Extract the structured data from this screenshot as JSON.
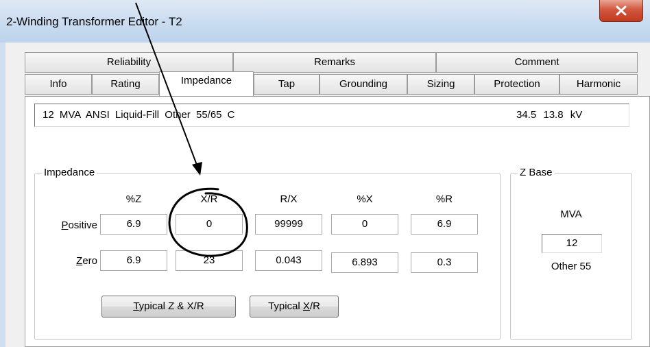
{
  "window": {
    "title": "2-Winding Transformer Editor - T2"
  },
  "tabs_top": [
    "Reliability",
    "Remarks",
    "Comment"
  ],
  "tabs_bottom": [
    "Info",
    "Rating",
    "Impedance",
    "Tap",
    "Grounding",
    "Sizing",
    "Protection",
    "Harmonic"
  ],
  "active_tab": "Impedance",
  "description": {
    "left": "12 MVA ANSI Liquid-Fill Other 55/65 C",
    "right": "34.5 13.8 kV"
  },
  "impedance": {
    "legend": "Impedance",
    "columns": [
      "%Z",
      "X/R",
      "R/X",
      "%X",
      "%R"
    ],
    "positive": {
      "label": "Positive",
      "mnemonic": "P",
      "rest": "ositive",
      "values": [
        "6.9",
        "0",
        "99999",
        "0",
        "6.9"
      ]
    },
    "zero": {
      "label": "Zero",
      "mnemonic": "Z",
      "rest": "ero",
      "values": [
        "6.9",
        "23",
        "0.043",
        "6.893",
        "0.3"
      ]
    }
  },
  "buttons": {
    "typical_z_xr": {
      "mnemonic": "T",
      "rest": "ypical Z & X/R"
    },
    "typical_xr": {
      "pre": "Typical ",
      "mnemonic": "X",
      "rest": "/R"
    }
  },
  "zbase": {
    "legend": "Z Base",
    "mva_label": "MVA",
    "mva_value": "12",
    "note": "Other 55"
  },
  "colors": {
    "annotation": "#000000",
    "close_button": "#c0391f",
    "titlebar": "#c9dbef"
  }
}
